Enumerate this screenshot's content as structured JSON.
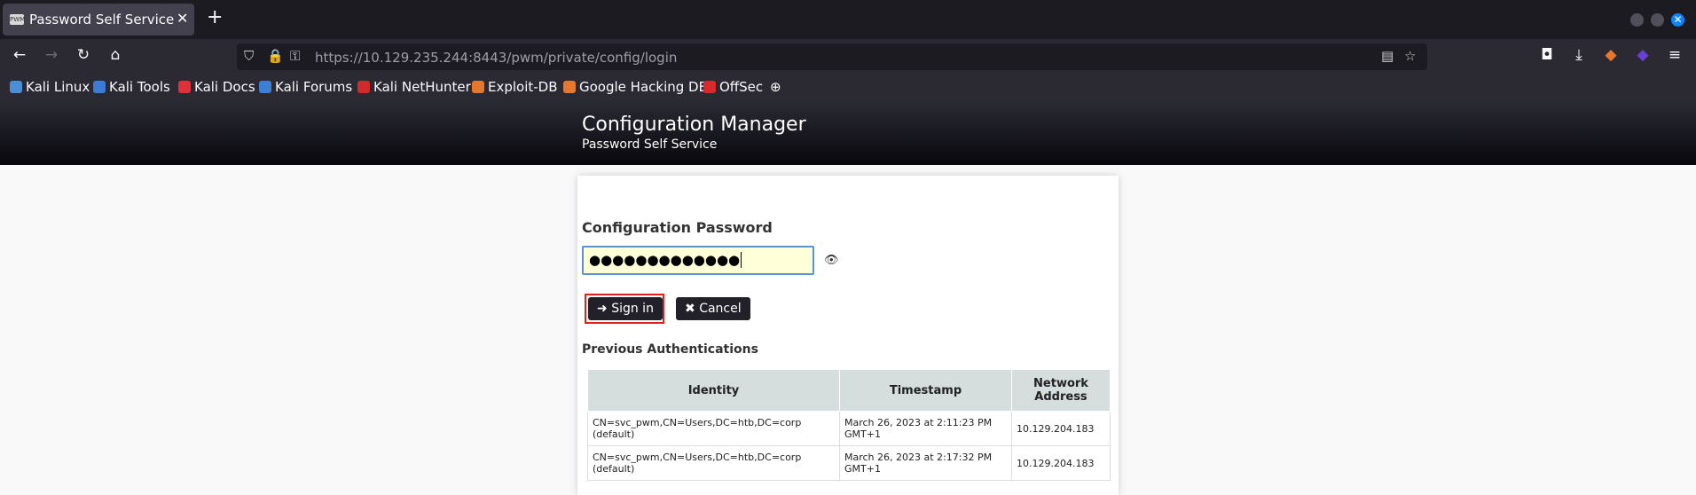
{
  "browser": {
    "tab": {
      "favicon_text": "PWM",
      "title": "Password Self Service"
    },
    "url": {
      "host": "https://10.129.235.244",
      "rest": ":8443/pwm/private/config/login"
    },
    "bookmarks": [
      {
        "label": "Kali Linux",
        "color": "#4a8fd6"
      },
      {
        "label": "Kali Tools",
        "color": "#3a7bd5"
      },
      {
        "label": "Kali Docs",
        "color": "#e0303a"
      },
      {
        "label": "Kali Forums",
        "color": "#3d7fd6"
      },
      {
        "label": "Kali NetHunter",
        "color": "#d02b2b"
      },
      {
        "label": "Exploit-DB",
        "color": "#e8772e"
      },
      {
        "label": "Google Hacking DB",
        "color": "#e8772e"
      },
      {
        "label": "OffSec",
        "color": "#d62b2b"
      }
    ]
  },
  "header": {
    "title": "Configuration Manager",
    "subtitle": "Password Self Service"
  },
  "login": {
    "label": "Configuration Password",
    "password_value": "●●●●●●●●●●●●●",
    "eye_icon": "👁",
    "signin_label": "Sign in",
    "cancel_label": "Cancel"
  },
  "previous": {
    "label": "Previous Authentications",
    "columns": [
      "Identity",
      "Timestamp",
      "Network Address"
    ],
    "rows": [
      {
        "identity": "CN=svc_pwm,CN=Users,DC=htb,DC=corp (default)",
        "timestamp": "March 26, 2023 at 2:11:23 PM GMT+1",
        "address": "10.129.204.183"
      },
      {
        "identity": "CN=svc_pwm,CN=Users,DC=htb,DC=corp (default)",
        "timestamp": "March 26, 2023 at 2:17:32 PM GMT+1",
        "address": "10.129.204.183"
      }
    ]
  }
}
